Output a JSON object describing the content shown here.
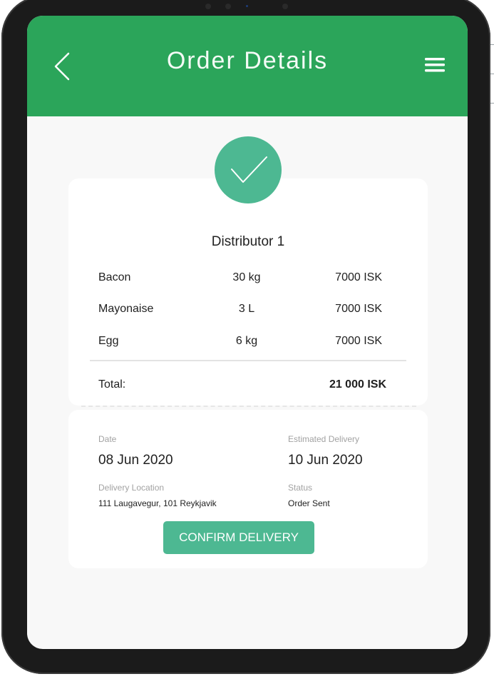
{
  "header": {
    "title": "Order Details",
    "back_icon": "chevron-left-icon",
    "menu_icon": "hamburger-menu-icon"
  },
  "order": {
    "status_icon": "checkmark-icon",
    "distributor": "Distributor 1",
    "items": [
      {
        "name": "Bacon",
        "quantity": "30 kg",
        "price": "7000 ISK"
      },
      {
        "name": "Mayonaise",
        "quantity": "3 L",
        "price": "7000 ISK"
      },
      {
        "name": "Egg",
        "quantity": "6 kg",
        "price": "7000 ISK"
      }
    ],
    "total_label": "Total:",
    "total_value": "21 000 ISK"
  },
  "details": {
    "date_label": "Date",
    "date_value": "08 Jun 2020",
    "estimated_label": "Estimated Delivery",
    "estimated_value": "10 Jun 2020",
    "location_label": "Delivery Location",
    "location_value": "111 Laugavegur, 101 Reykjavik",
    "status_label": "Status",
    "status_value": "Order Sent"
  },
  "actions": {
    "confirm_label": "CONFIRM DELIVERY"
  },
  "colors": {
    "header": "#2ba55a",
    "accent": "#4db892",
    "background": "#f8f8f8",
    "device_frame": "#1b1b1b"
  }
}
